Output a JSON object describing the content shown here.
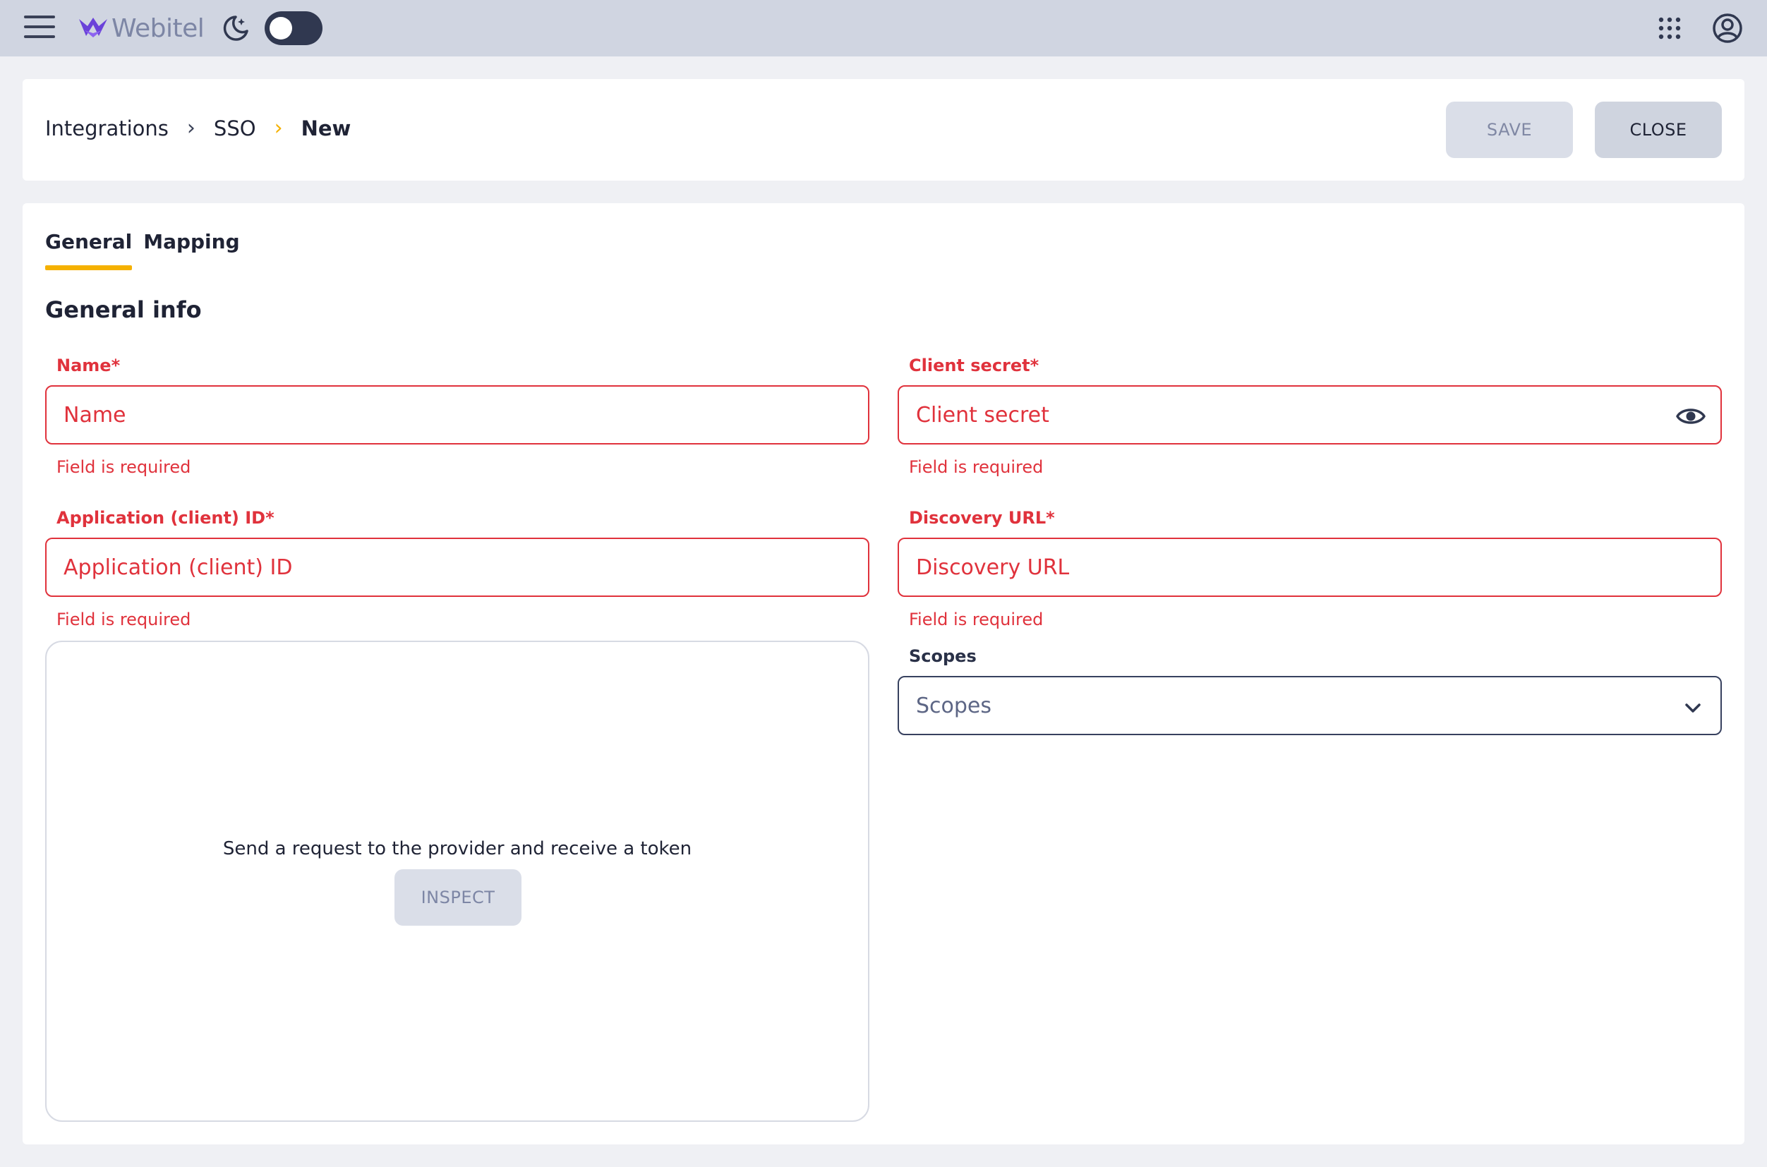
{
  "topbar": {
    "logo_text": "Webitel",
    "menu_icon": "hamburger-menu-icon",
    "theme_icon": "moon-stars-icon",
    "apps_icon": "apps-grid-icon",
    "account_icon": "account-circle-icon",
    "dark_mode_enabled": false
  },
  "breadcrumb": {
    "items": [
      "Integrations",
      "SSO",
      "New"
    ],
    "separator": "›"
  },
  "actions": {
    "save_label": "SAVE",
    "close_label": "CLOSE"
  },
  "tabs": [
    {
      "label": "General",
      "active": true
    },
    {
      "label": "Mapping",
      "active": false
    }
  ],
  "section_title": "General info",
  "fields": {
    "name": {
      "label": "Name*",
      "placeholder": "Name",
      "value": "",
      "error": "Field is required"
    },
    "client_secret": {
      "label": "Client secret*",
      "placeholder": "Client secret",
      "value": "",
      "error": "Field is required"
    },
    "client_id": {
      "label": "Application (client) ID*",
      "placeholder": "Application (client) ID",
      "value": "",
      "error": "Field is required"
    },
    "discovery_url": {
      "label": "Discovery URL*",
      "placeholder": "Discovery URL",
      "value": "",
      "error": "Field is required"
    },
    "scopes": {
      "label": "Scopes",
      "placeholder": "Scopes",
      "value": ""
    }
  },
  "inspect": {
    "text": "Send a request to the provider and receive a token",
    "button_label": "INSPECT"
  },
  "colors": {
    "accent": "#f5b100",
    "error": "#e0323c",
    "topbar": "#d0d5e1",
    "background": "#eff0f4"
  }
}
